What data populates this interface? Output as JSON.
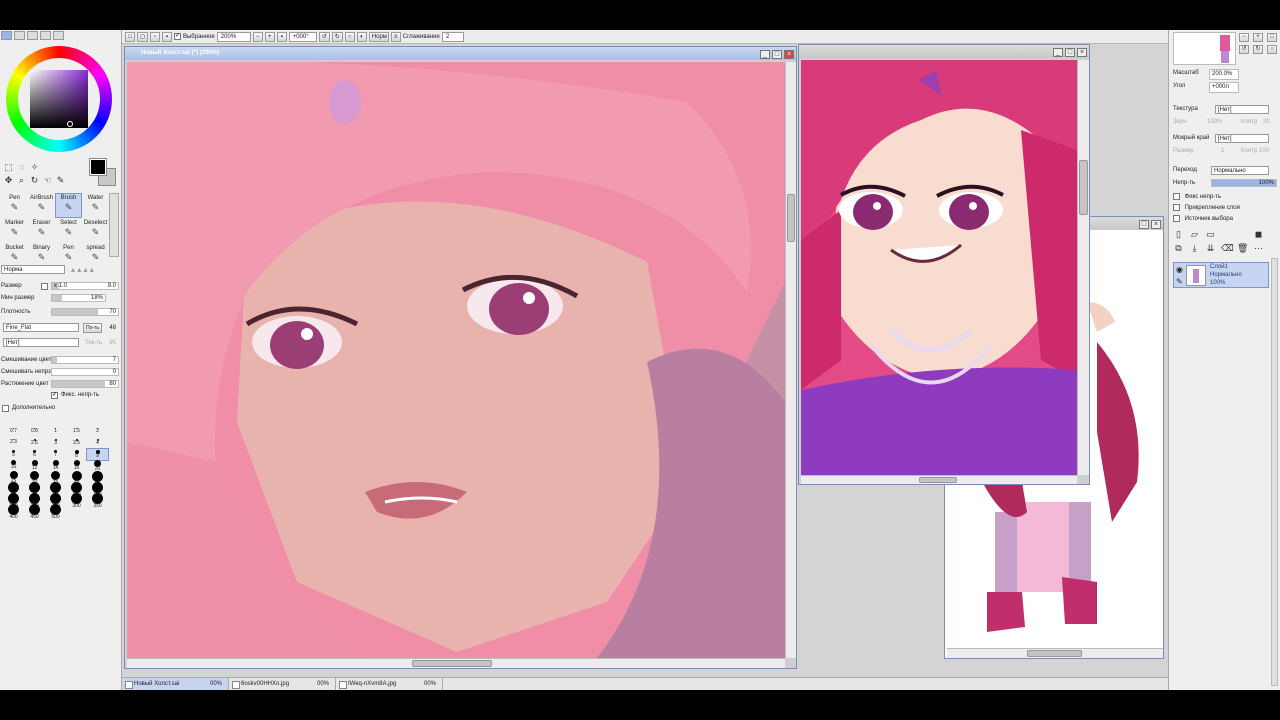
{
  "toolbar": {
    "selection_label": "Выбранное",
    "zoom": "200%",
    "angle": "+000°",
    "blend": "Норм",
    "smoothing_label": "Сглаживание",
    "smoothing_value": "2"
  },
  "tools": [
    {
      "label": "Pen",
      "icon": "pen-icon"
    },
    {
      "label": "AirBrush",
      "icon": "airbrush-icon"
    },
    {
      "label": "Brush",
      "icon": "brush-icon",
      "selected": true
    },
    {
      "label": "Water",
      "icon": "water-icon"
    },
    {
      "label": "Marker",
      "icon": "marker-icon"
    },
    {
      "label": "Eraser",
      "icon": "eraser-icon"
    },
    {
      "label": "Select",
      "icon": "select-icon"
    },
    {
      "label": "Deselect",
      "icon": "deselect-icon"
    },
    {
      "label": "Bucket",
      "icon": "bucket-icon"
    },
    {
      "label": "Binary",
      "icon": "binary-icon"
    },
    {
      "label": "Pen",
      "icon": "pen2-icon"
    },
    {
      "label": "spread",
      "icon": "spread-icon"
    }
  ],
  "brush": {
    "mode": "Норма",
    "size_label": "Размер",
    "size_mult": "x 1.0",
    "size_value": "9.0",
    "min_size_label": "Мин размер",
    "min_size_value": "18%",
    "density_label": "Плотность",
    "density_value": "70",
    "texture_select": "Fine_Flat",
    "texture_button": "По-ть",
    "texture_value": "48",
    "paper_select": "[Нет]",
    "paper_hint": "Тек-ть",
    "paper_hint_value": "95",
    "blend_label": "Смешивание цвет",
    "blend_value": "7",
    "dilution_label": "Смешивать непрз",
    "dilution_value": "0",
    "persistence_label": "Растяжение цвет",
    "persistence_value": "80",
    "keep_opacity_label": "Фикс. непр-ть",
    "advanced_label": "Дополнительно"
  },
  "brush_sizes": [
    "0.7",
    "0.8",
    "1",
    "1.5",
    "2",
    "2.3",
    "2.6",
    "3",
    "3.5",
    "4",
    "5",
    "6",
    "7",
    "8",
    "9",
    "10",
    "12",
    "14",
    "16",
    "20",
    "25",
    "30",
    "35",
    "40",
    "50",
    "60",
    "70",
    "80",
    "100",
    "120",
    "160",
    "200",
    "250",
    "300",
    "350",
    "400",
    "450",
    "500"
  ],
  "windows": {
    "main_title": "Новый Холст.sai (*) (200%)",
    "ref1_title": "",
    "ref2_title": ""
  },
  "tabs": [
    {
      "name": "Новый Холст.sai",
      "pct": "00%"
    },
    {
      "name": "6oskv00HHXo.jpg",
      "pct": "00%"
    },
    {
      "name": "IWeq-nXvm8A.jpg",
      "pct": "00%"
    }
  ],
  "right_panel": {
    "zoom_label": "Масштаб",
    "zoom_value": "200.0%",
    "angle_label": "Угол",
    "angle_value": "+000л",
    "texture_label": "Текстура",
    "texture_value": "[Нет]",
    "scale_label": "Зерн",
    "scale_value": "100%",
    "contrast_label": "Контр",
    "contrast_value": "20",
    "effect_label": "Мокрый край",
    "effect_value": "[Нет]",
    "width_label": "Размер",
    "width_value": "1",
    "strength_label": "Контр",
    "strength_value": "100",
    "mode_label": "Переход",
    "mode_value": "Нормально",
    "opacity_label": "Непр-ть",
    "opacity_value": "100%",
    "preserve_opacity": "Фикс непр-ть",
    "clipping": "Прикрепление слоя",
    "selection_source": "Источник выбора",
    "layer_name": "Слой1",
    "layer_mode": "Нормально",
    "layer_opacity": "100%"
  }
}
